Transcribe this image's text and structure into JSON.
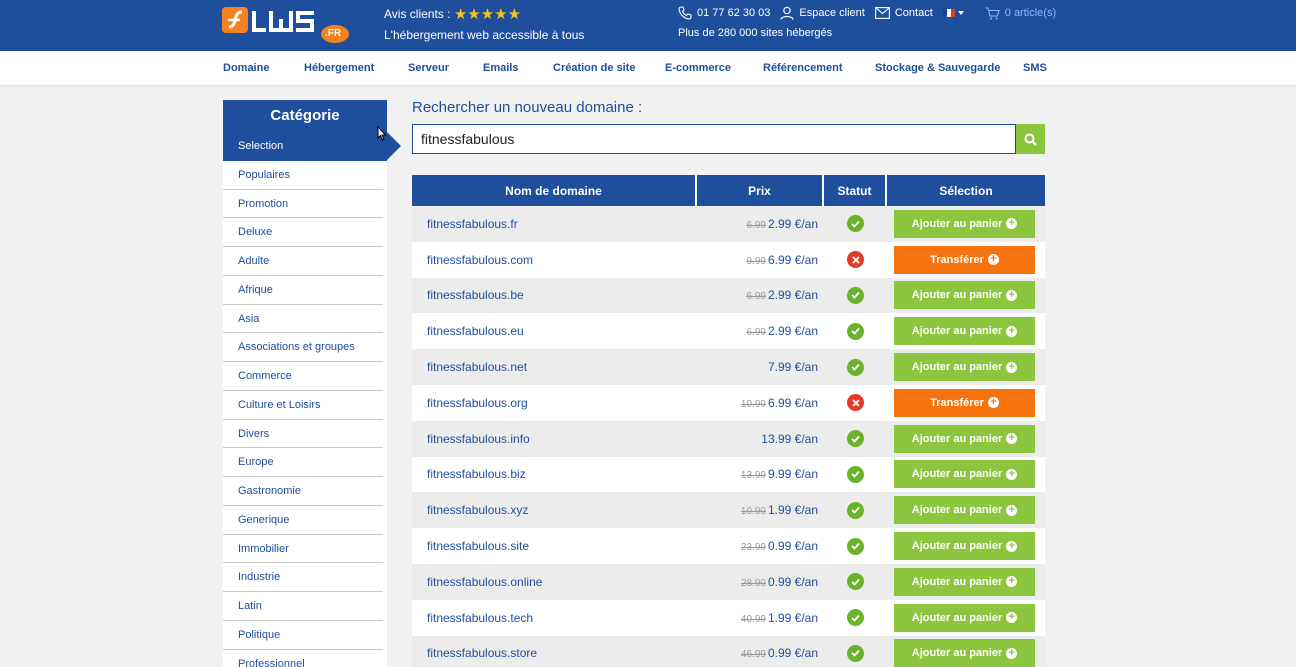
{
  "brand": {
    "logo_text": "LWS",
    "logo_tld": ".FR",
    "colors": {
      "primary": "#1f4e9c",
      "accent_green": "#8cc63f",
      "accent_orange": "#f7730e",
      "logo_orange": "#f58220"
    }
  },
  "topbar": {
    "reviews_label": "Avis clients :",
    "stars": "★★★★★",
    "tagline": "L'hébergement web accessible à tous",
    "phone": "01 77 62 30 03",
    "account": "Espace client",
    "contact": "Contact",
    "cart": "0 article(s)",
    "sites_hosted": "Plus de 280 000 sites hébergés"
  },
  "nav": {
    "items": [
      {
        "label": "Domaine"
      },
      {
        "label": "Hébergement"
      },
      {
        "label": "Serveur"
      },
      {
        "label": "Emails"
      },
      {
        "label": "Création de site"
      },
      {
        "label": "E-commerce"
      },
      {
        "label": "Référencement"
      },
      {
        "label": "Stockage & Sauvegarde"
      },
      {
        "label": "SMS"
      }
    ]
  },
  "sidebar": {
    "title": "Catégorie",
    "items": [
      {
        "label": "Selection"
      },
      {
        "label": "Populaires"
      },
      {
        "label": "Promotion"
      },
      {
        "label": "Deluxe"
      },
      {
        "label": "Adulte"
      },
      {
        "label": "Afrique"
      },
      {
        "label": "Asia"
      },
      {
        "label": "Associations et groupes"
      },
      {
        "label": "Commerce"
      },
      {
        "label": "Culture et Loisirs"
      },
      {
        "label": "Divers"
      },
      {
        "label": "Europe"
      },
      {
        "label": "Gastronomie"
      },
      {
        "label": "Generique"
      },
      {
        "label": "Immobilier"
      },
      {
        "label": "Industrie"
      },
      {
        "label": "Latin"
      },
      {
        "label": "Politique"
      },
      {
        "label": "Professionnel"
      }
    ]
  },
  "search": {
    "label": "Rechercher un nouveau domaine :",
    "value": "fitnessfabulous"
  },
  "table": {
    "headers": {
      "domain": "Nom de domaine",
      "price": "Prix",
      "status": "Statut",
      "selection": "Sélection"
    },
    "add_label": "Ajouter au panier",
    "transfer_label": "Transférer",
    "rows": [
      {
        "domain": "fitnessfabulous.fr",
        "old_price": "6.99",
        "price": "2.99 €/an",
        "available": true
      },
      {
        "domain": "fitnessfabulous.com",
        "old_price": "9.99",
        "price": "6.99 €/an",
        "available": false
      },
      {
        "domain": "fitnessfabulous.be",
        "old_price": "6.99",
        "price": "2.99 €/an",
        "available": true
      },
      {
        "domain": "fitnessfabulous.eu",
        "old_price": "6.99",
        "price": "2.99 €/an",
        "available": true
      },
      {
        "domain": "fitnessfabulous.net",
        "old_price": "",
        "price": "7.99 €/an",
        "available": true
      },
      {
        "domain": "fitnessfabulous.org",
        "old_price": "10.99",
        "price": "6.99 €/an",
        "available": false
      },
      {
        "domain": "fitnessfabulous.info",
        "old_price": "",
        "price": "13.99 €/an",
        "available": true
      },
      {
        "domain": "fitnessfabulous.biz",
        "old_price": "13.99",
        "price": "9.99 €/an",
        "available": true
      },
      {
        "domain": "fitnessfabulous.xyz",
        "old_price": "10.99",
        "price": "1.99 €/an",
        "available": true
      },
      {
        "domain": "fitnessfabulous.site",
        "old_price": "23.99",
        "price": "0.99 €/an",
        "available": true
      },
      {
        "domain": "fitnessfabulous.online",
        "old_price": "28.99",
        "price": "0.99 €/an",
        "available": true
      },
      {
        "domain": "fitnessfabulous.tech",
        "old_price": "40.99",
        "price": "1.99 €/an",
        "available": true
      },
      {
        "domain": "fitnessfabulous.store",
        "old_price": "46.99",
        "price": "0.99 €/an",
        "available": true
      }
    ]
  }
}
